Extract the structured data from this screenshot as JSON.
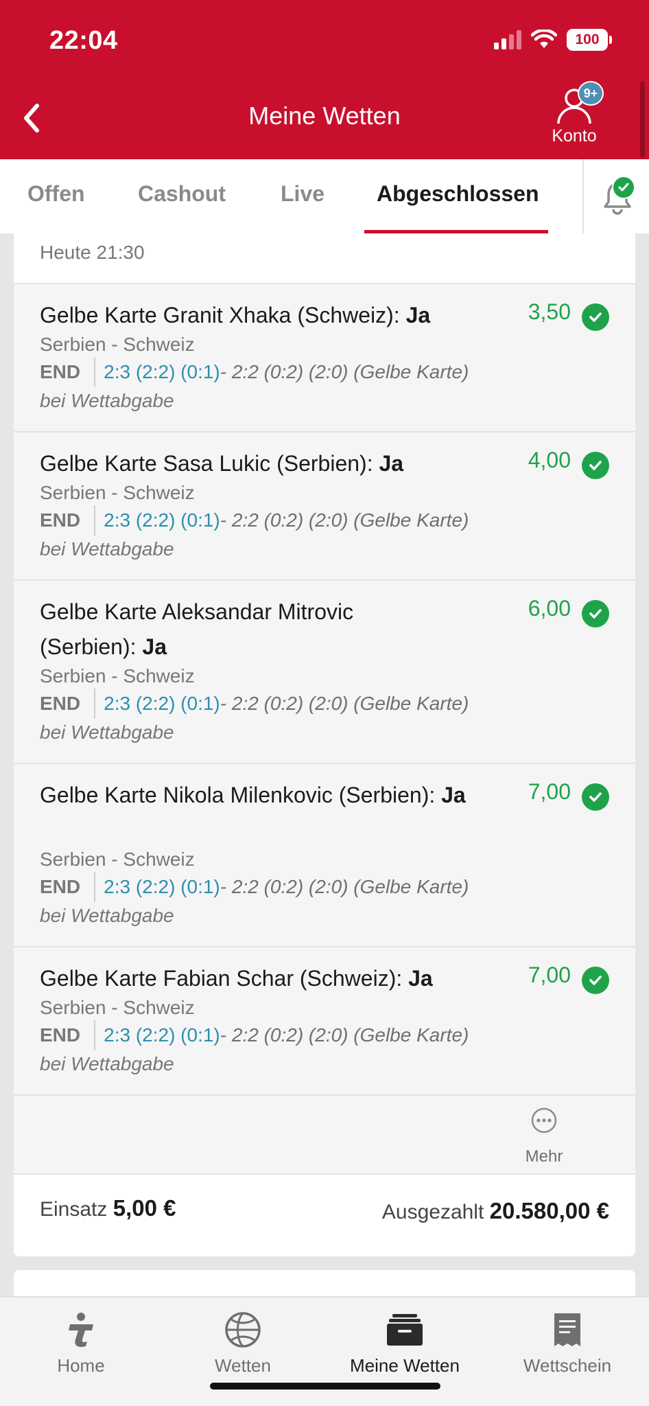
{
  "status_bar": {
    "time": "22:04",
    "battery": "100"
  },
  "header": {
    "title": "Meine Wetten",
    "account_label": "Konto",
    "account_badge": "9+"
  },
  "tabs": [
    {
      "label": "Offen"
    },
    {
      "label": "Cashout"
    },
    {
      "label": "Live"
    },
    {
      "label": "Abgeschlossen",
      "active": true
    }
  ],
  "bet": {
    "date": "Heute 21:30",
    "legs": [
      {
        "title": "Gelbe Karte Granit Xhaka (Schweiz): ",
        "pick": "Ja",
        "odds": "3,50",
        "match": "Serbien - Schweiz",
        "status": "END",
        "score": "2:3 (2:2) (0:1)",
        "detail": "- 2:2 (0:2) (2:0) (Gelbe Karte)",
        "note": "bei Wettabgabe"
      },
      {
        "title": "Gelbe Karte Sasa Lukic (Serbien): ",
        "pick": "Ja",
        "odds": "4,00",
        "match": "Serbien - Schweiz",
        "status": "END",
        "score": "2:3 (2:2) (0:1)",
        "detail": "- 2:2 (0:2) (2:0) (Gelbe Karte)",
        "note": "bei Wettabgabe"
      },
      {
        "title": "Gelbe Karte Aleksandar Mitrovic (Serbien): ",
        "pick": "Ja",
        "odds": "6,00",
        "match": "Serbien - Schweiz",
        "status": "END",
        "score": "2:3 (2:2) (0:1)",
        "detail": "- 2:2 (0:2) (2:0) (Gelbe Karte)",
        "note": "bei Wettabgabe"
      },
      {
        "title": "Gelbe Karte Nikola Milenkovic (Serbien): ",
        "pick": "Ja",
        "odds": "7,00",
        "match": "Serbien - Schweiz",
        "status": "END",
        "score": "2:3 (2:2) (0:1)",
        "detail": "- 2:2 (0:2) (2:0) (Gelbe Karte)",
        "note": "bei Wettabgabe"
      },
      {
        "title": "Gelbe Karte Fabian Schar (Schweiz): ",
        "pick": "Ja",
        "odds": "7,00",
        "match": "Serbien - Schweiz",
        "status": "END",
        "score": "2:3 (2:2) (0:1)",
        "detail": "- 2:2 (0:2) (2:0) (Gelbe Karte)",
        "note": "bei Wettabgabe"
      }
    ],
    "more_label": "Mehr",
    "stake_label": "Einsatz",
    "stake_value": "5,00 €",
    "payout_label": "Ausgezahlt",
    "payout_value": "20.580,00 €"
  },
  "bottom_nav": [
    {
      "label": "Home",
      "icon": "tipico-home-icon"
    },
    {
      "label": "Wetten",
      "icon": "sports-ball-icon"
    },
    {
      "label": "Meine Wetten",
      "icon": "my-bets-icon",
      "active": true
    },
    {
      "label": "Wettschein",
      "icon": "betslip-icon"
    }
  ],
  "colors": {
    "brand_red": "#c8102e",
    "win_green": "#1fa34a",
    "score_blue": "#2d8fb0"
  }
}
